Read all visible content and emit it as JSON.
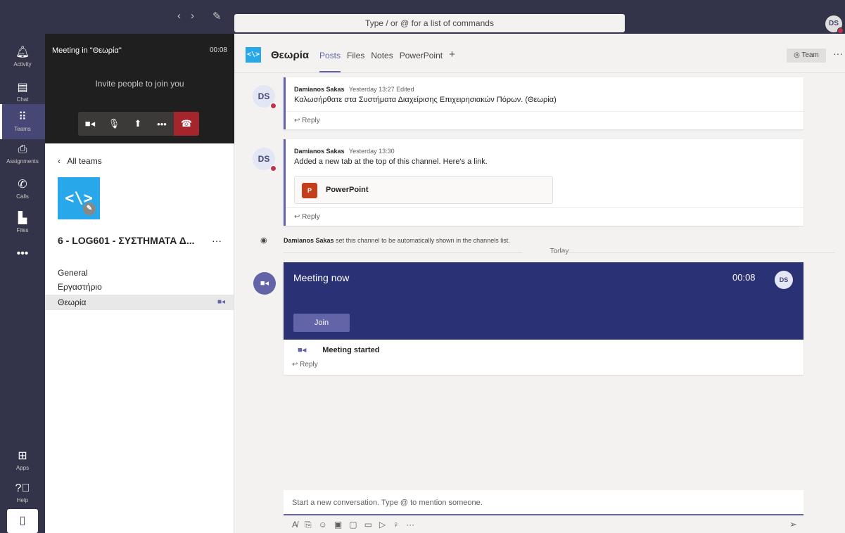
{
  "topbar": {
    "back": "‹",
    "forward": "›",
    "compose": "✎",
    "search_placeholder": "Type / or @ for a list of commands",
    "avatar": "DS"
  },
  "rail": {
    "items": [
      {
        "label": "Activity",
        "icon": "bell-icon"
      },
      {
        "label": "Chat",
        "icon": "chat-icon"
      },
      {
        "label": "Teams",
        "icon": "teams-icon"
      },
      {
        "label": "Assignments",
        "icon": "assignments-icon"
      },
      {
        "label": "Calls",
        "icon": "phone-icon"
      },
      {
        "label": "Files",
        "icon": "file-icon"
      }
    ],
    "more": "•••",
    "apps": "Apps",
    "help": "Help"
  },
  "meeting_panel": {
    "title": "Meeting in \"Θεωρία\"",
    "time": "00:08",
    "invite": "Invite people to join you"
  },
  "team_panel": {
    "all_teams": "All teams",
    "team_name": "6 - LOG601 - ΣΥΣΤΗΜΑΤΑ Δ...",
    "channels": [
      "General",
      "Εργαστήριο",
      "Θεωρία"
    ]
  },
  "channel_header": {
    "name": "Θεωρία",
    "tabs": [
      "Posts",
      "Files",
      "Notes",
      "PowerPoint"
    ],
    "team_button": "Team"
  },
  "messages": [
    {
      "avatar": "DS",
      "author": "Damianos Sakas",
      "time": "Yesterday 13:27",
      "edited": "Edited",
      "text": "Καλωσήρθατε στα Συστήματα Διαχείρισης Επιχειρησιακών Πόρων. (Θεωρία)",
      "reply": "Reply"
    },
    {
      "avatar": "DS",
      "author": "Damianos Sakas",
      "time": "Yesterday 13:30",
      "text": "Added a new tab at the top of this channel. Here's a link.",
      "attachment": "PowerPoint",
      "reply": "Reply"
    }
  ],
  "event": {
    "author": "Damianos Sakas",
    "text": "set this channel to be automatically shown in the channels list."
  },
  "divider": "Today",
  "meeting_card": {
    "title": "Meeting now",
    "time": "00:08",
    "avatar": "DS",
    "join": "Join",
    "started": "Meeting started",
    "reply": "Reply"
  },
  "compose": {
    "placeholder": "Start a new conversation. Type @ to mention someone."
  }
}
